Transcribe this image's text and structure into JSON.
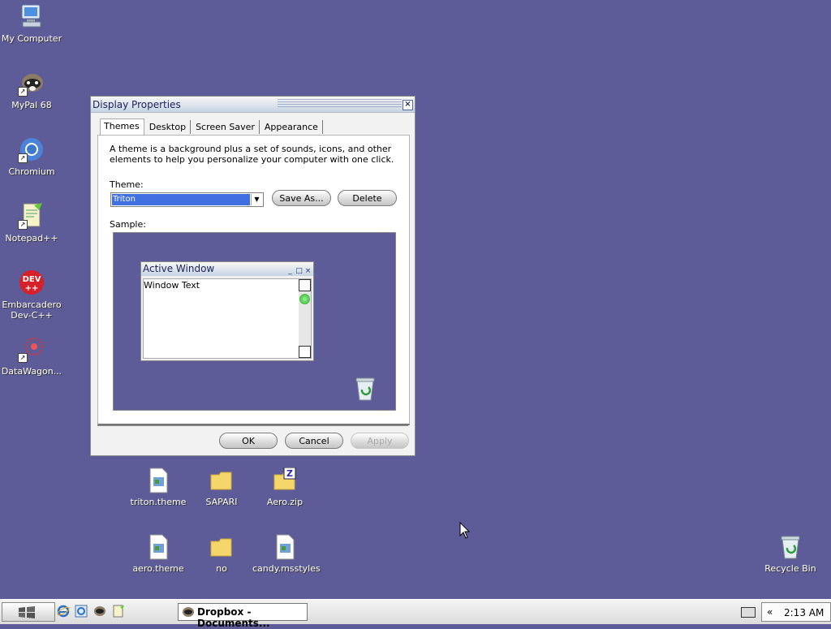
{
  "desktop": {
    "icons": [
      {
        "label": "My Computer"
      },
      {
        "label": "MyPal 68"
      },
      {
        "label": "Chromium"
      },
      {
        "label": "Notepad++"
      },
      {
        "label": "Embarcadero Dev-C++"
      },
      {
        "label": "DataWagon..."
      }
    ],
    "files": [
      {
        "label": "triton.theme"
      },
      {
        "label": "SAPARI"
      },
      {
        "label": "Aero.zip"
      },
      {
        "label": "aero.theme"
      },
      {
        "label": "no"
      },
      {
        "label": "candy.msstyles"
      }
    ],
    "recycle_bin": "Recycle Bin"
  },
  "dialog": {
    "title": "Display Properties",
    "tabs": [
      "Themes",
      "Desktop",
      "Screen Saver",
      "Appearance"
    ],
    "active_tab": "Themes",
    "description": "A theme is a background plus a set of sounds, icons, and other elements to help you personalize your computer with one click.",
    "theme_label": "Theme:",
    "theme_value": "Triton",
    "save_as_label": "Save As...",
    "delete_label": "Delete",
    "sample_label": "Sample:",
    "sample": {
      "active_window_title": "Active Window",
      "window_text": "Window Text"
    },
    "ok_label": "OK",
    "cancel_label": "Cancel",
    "apply_label": "Apply"
  },
  "taskbar": {
    "task_label": "Dropbox - Documents...",
    "chevron": "«",
    "clock": "2:13 AM"
  }
}
